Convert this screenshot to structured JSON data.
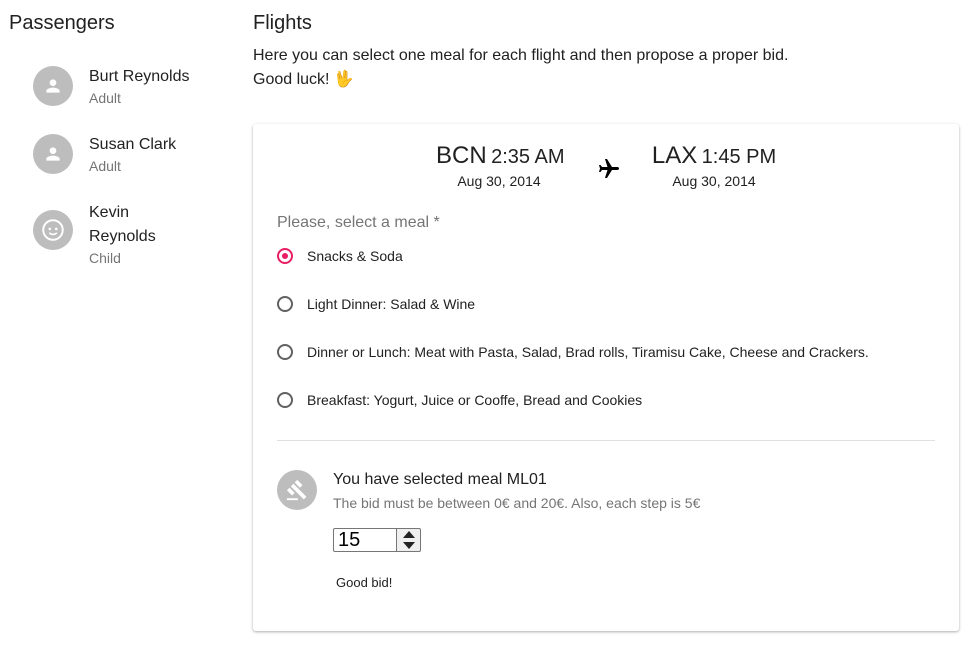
{
  "passengers": {
    "title": "Passengers",
    "items": [
      {
        "name": "Burt Reynolds",
        "type": "Adult",
        "icon": "person-icon"
      },
      {
        "name": "Susan Clark",
        "type": "Adult",
        "icon": "person-icon"
      },
      {
        "name": "Kevin Reynolds",
        "type": "Child",
        "icon": "child-face-icon"
      }
    ]
  },
  "flights": {
    "title": "Flights",
    "intro_line1": "Here you can select one meal for each flight and then propose a proper bid.",
    "intro_line2": "Good luck! 🖖",
    "departure": {
      "code": "BCN",
      "time": "2:35 AM",
      "date": "Aug 30, 2014"
    },
    "arrival": {
      "code": "LAX",
      "time": "1:45 PM",
      "date": "Aug 30, 2014"
    },
    "plane_icon": "airplane-icon",
    "meal_label": "Please, select a meal *",
    "meals": [
      {
        "label": "Snacks & Soda",
        "selected": true
      },
      {
        "label": "Light Dinner: Salad & Wine",
        "selected": false
      },
      {
        "label": "Dinner or Lunch: Meat with Pasta, Salad, Brad rolls, Tiramisu Cake, Cheese and Crackers.",
        "selected": false
      },
      {
        "label": "Breakfast: Yogurt, Juice or Cooffe, Bread and Cookies",
        "selected": false
      }
    ],
    "bid": {
      "icon": "gavel-icon",
      "title": "You have selected meal ML01",
      "subtitle": "The bid must be between 0€ and 20€. Also, each step is 5€",
      "value": "15",
      "feedback": "Good bid!"
    }
  },
  "colors": {
    "accent": "#e91e63",
    "avatar_bg": "#bdbdbd",
    "secondary_text": "#757575"
  }
}
